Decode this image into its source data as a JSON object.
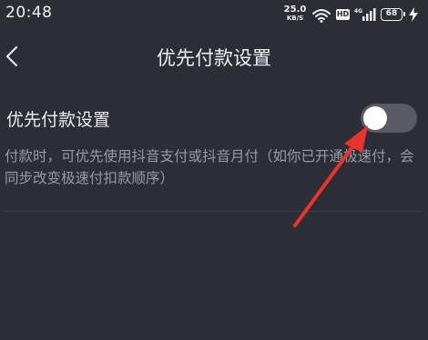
{
  "status_bar": {
    "time": "20:48",
    "net_speed_value": "25.0",
    "net_speed_unit": "KB/S",
    "hd_label": "HD",
    "battery_level": "68",
    "icons": [
      "wifi-icon",
      "signal-icon",
      "battery-icon",
      "charging-bolt-icon"
    ]
  },
  "header": {
    "title": "优先付款设置",
    "back_icon": "chevron-left-icon"
  },
  "setting": {
    "label": "优先付款设置",
    "toggle_on": false,
    "description": "付款时，可优先使用抖音支付或抖音月付（如你已开通极速付，会同步改变极速付扣款顺序）"
  },
  "colors": {
    "background": "#2d2d36",
    "toggle_track": "#5a5a64",
    "toggle_knob": "#ffffff",
    "annotation_arrow": "#e8342c"
  }
}
